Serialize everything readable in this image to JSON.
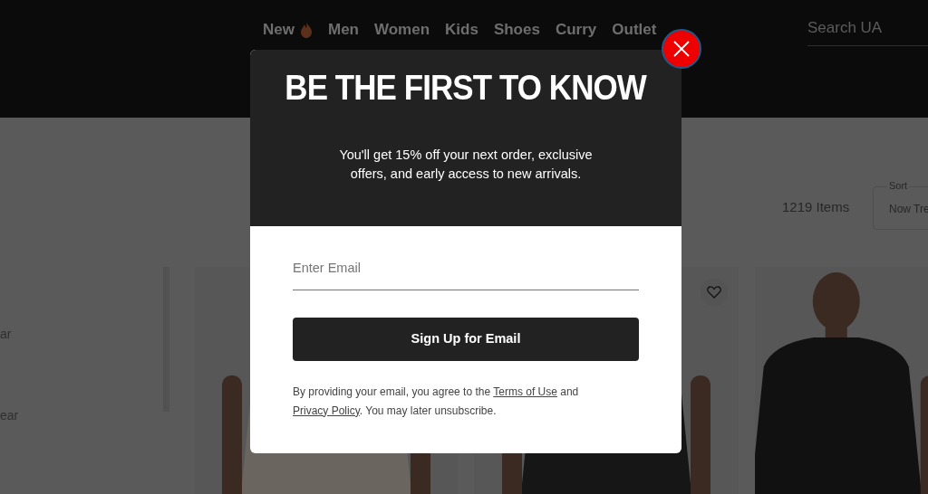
{
  "nav": {
    "items": [
      {
        "label": "New",
        "kind": "hot"
      },
      {
        "label": "Men",
        "kind": "plain"
      },
      {
        "label": "Women",
        "kind": "plain"
      },
      {
        "label": "Kids",
        "kind": "plain"
      },
      {
        "label": "Shoes",
        "kind": "plain"
      },
      {
        "label": "Curry",
        "kind": "plain"
      },
      {
        "label": "Outlet",
        "kind": "plain"
      }
    ]
  },
  "search": {
    "placeholder": "Search UA"
  },
  "sidebar": {
    "items": [
      "ar",
      "ear"
    ]
  },
  "results": {
    "count": "1219 Items",
    "sort": {
      "label": "Sort",
      "value": "Now Tre"
    }
  },
  "products": [
    {
      "kind": "picture",
      "favorite_button": false
    },
    {
      "kind": "picture",
      "favorite_button": true
    },
    {
      "kind": "picture",
      "favorite_button": false
    }
  ],
  "modal": {
    "title": "BE THE FIRST TO KNOW",
    "message": "You'll get 15% off your next order, exclusive offers, and early access to new arrivals.",
    "email": {
      "placeholder": "Enter Email"
    },
    "button": "Sign Up for Email",
    "legal": [
      {
        "kind": "text",
        "text": "By providing your email, you agree to the "
      },
      {
        "kind": "link",
        "text": "Terms of Use"
      },
      {
        "kind": "text",
        "text": " and "
      },
      {
        "kind": "link",
        "text": "Privacy Policy"
      },
      {
        "kind": "text",
        "text": ".  You may later unsubscribe."
      }
    ]
  }
}
